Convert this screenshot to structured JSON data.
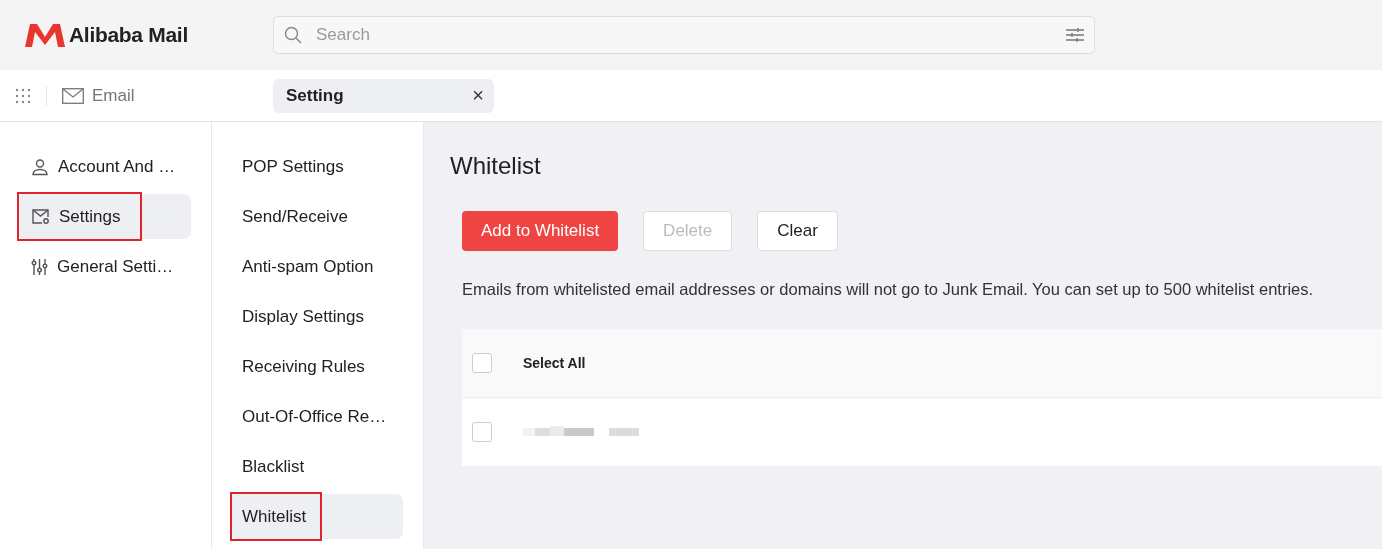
{
  "header": {
    "logo_text": "Alibaba Mail",
    "search": {
      "placeholder": "Search"
    }
  },
  "tabbar": {
    "app_link": "Email",
    "tabs": [
      {
        "label": "Setting",
        "selected": true,
        "close": "×"
      }
    ]
  },
  "sidebar": {
    "items": [
      {
        "label": "Account And …",
        "kind": "user",
        "selected": false,
        "highlighted": false
      },
      {
        "label": "Settings",
        "kind": "mail-gear",
        "selected": true,
        "highlighted": true
      },
      {
        "label": "General Setti…",
        "kind": "sliders",
        "selected": false,
        "highlighted": false
      }
    ]
  },
  "submenu": {
    "items": [
      {
        "label": "POP Settings",
        "selected": false,
        "highlighted": false
      },
      {
        "label": "Send/Receive",
        "selected": false,
        "highlighted": false
      },
      {
        "label": "Anti-spam Option",
        "selected": false,
        "highlighted": false
      },
      {
        "label": "Display Settings",
        "selected": false,
        "highlighted": false
      },
      {
        "label": "Receiving Rules",
        "selected": false,
        "highlighted": false
      },
      {
        "label": "Out-Of-Office Re…",
        "selected": false,
        "highlighted": false
      },
      {
        "label": "Blacklist",
        "selected": false,
        "highlighted": false
      },
      {
        "label": "Whitelist",
        "selected": true,
        "highlighted": true
      }
    ]
  },
  "main": {
    "title": "Whitelist",
    "buttons": [
      {
        "label": "Add to Whitelist",
        "kind": "primary",
        "disabled": false
      },
      {
        "label": "Delete",
        "kind": "default",
        "disabled": true
      },
      {
        "label": "Clear",
        "kind": "default",
        "disabled": false
      }
    ],
    "description": "Emails from whitelisted email addresses or domains will not go to Junk Email. You can set up to 500 whitelist entries.",
    "table": {
      "select_all": {
        "label": "Select All",
        "checked": false
      },
      "rows": [
        {
          "kind": "redacted",
          "checked": false
        }
      ]
    }
  }
}
